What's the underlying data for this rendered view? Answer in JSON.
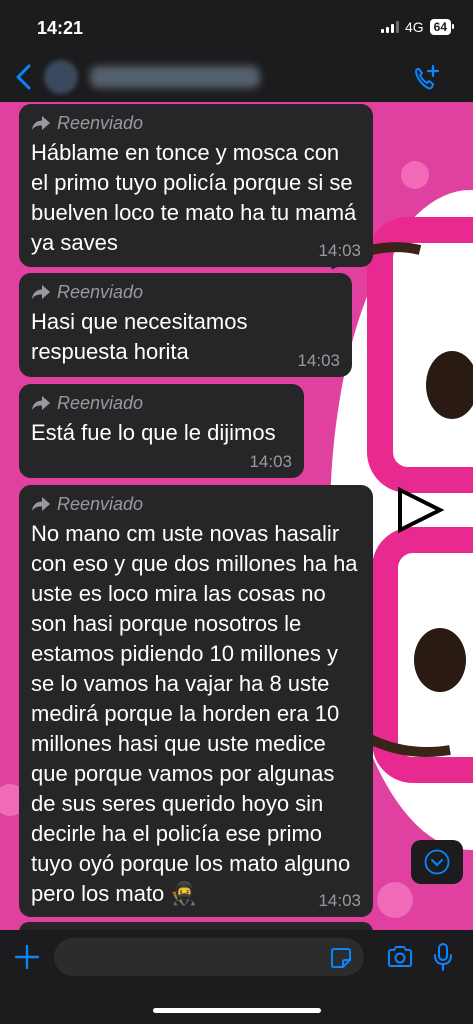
{
  "status_bar": {
    "time": "14:21",
    "network": "4G",
    "battery": "64"
  },
  "header": {
    "contact_name": ""
  },
  "messages": [
    {
      "forwarded_label": "Reenviado",
      "text": "Háblame en tonce y mosca con el primo tuyo policía porque si se buelven loco te mato ha tu mamá ya saves",
      "time": "14:03"
    },
    {
      "forwarded_label": "Reenviado",
      "text": "Hasi que necesitamos respuesta horita",
      "time": "14:03"
    },
    {
      "forwarded_label": "Reenviado",
      "text": "Está fue lo que le dijimos",
      "time": "14:03"
    },
    {
      "forwarded_label": "Reenviado",
      "text": "No mano cm uste novas hasalir con eso y que dos millones ha ha uste es loco mira las cosas no son hasi porque nosotros le estamos pidiendo 10 millones y se lo vamos ha vajar ha 8 uste medirá porque la horden era 10 millones hasi que uste medice que porque vamos por algunas de sus seres querido hoyo sin decirle ha el policía ese primo tuyo oyó porque los mato alguno pero los mato 🥷",
      "time": "14:03"
    }
  ],
  "input": {
    "placeholder": "",
    "value": ""
  },
  "colors": {
    "accent": "#0a84ff",
    "bubble": "#262628",
    "wallpaper": "#e040a0",
    "bar": "#1c1c1e"
  },
  "icons": [
    "back-icon",
    "video-call-icon",
    "forward-icon",
    "scroll-down-icon",
    "plus-icon",
    "sticker-icon",
    "camera-icon",
    "mic-icon"
  ]
}
